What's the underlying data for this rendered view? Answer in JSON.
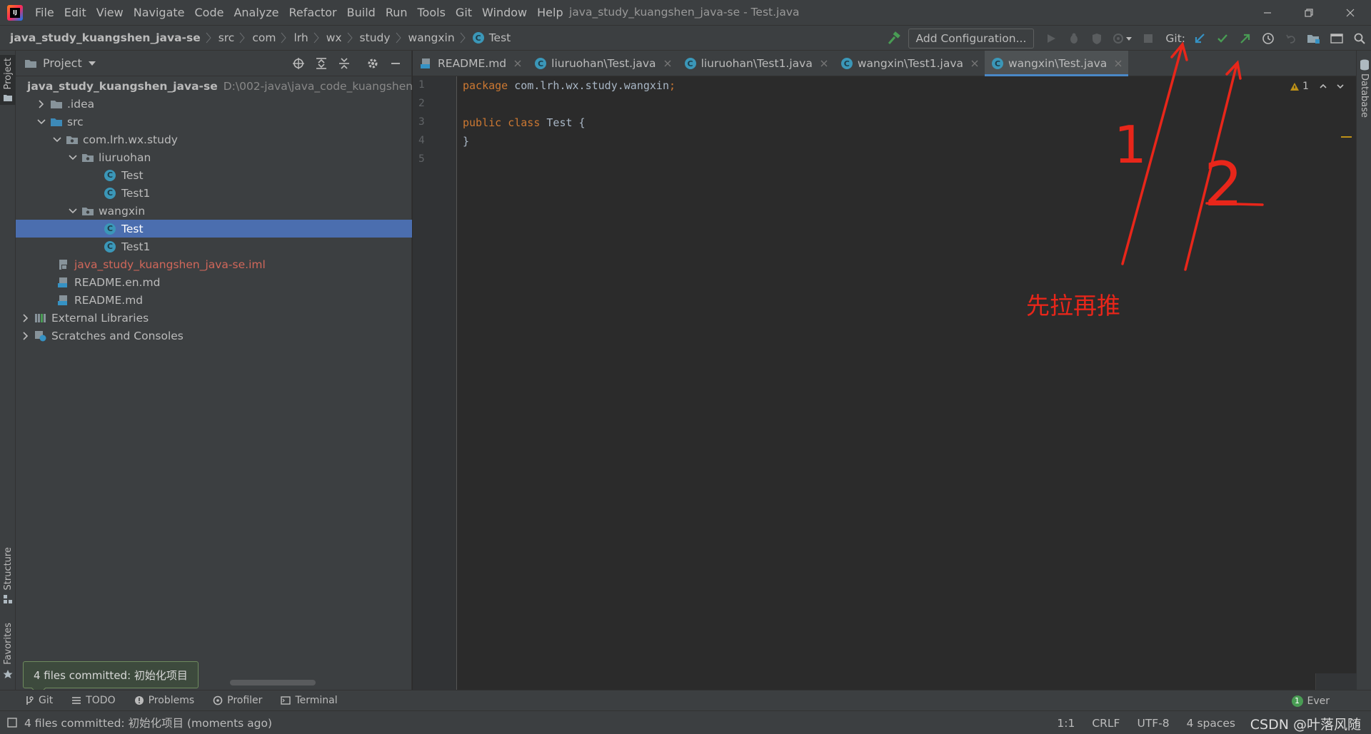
{
  "window": {
    "title": "java_study_kuangshen_java-se - Test.java",
    "menu": [
      "File",
      "Edit",
      "View",
      "Navigate",
      "Code",
      "Analyze",
      "Refactor",
      "Build",
      "Run",
      "Tools",
      "Git",
      "Window",
      "Help"
    ]
  },
  "navbar": {
    "breadcrumbs": [
      "java_study_kuangshen_java-se",
      "src",
      "com",
      "lrh",
      "wx",
      "study",
      "wangxin",
      "Test"
    ],
    "add_config_label": "Add Configuration...",
    "git_label": "Git:"
  },
  "left_stripe": {
    "project": "Project",
    "structure": "Structure",
    "favorites": "Favorites"
  },
  "right_stripe": {
    "database": "Database"
  },
  "project_panel": {
    "title": "Project",
    "tree": [
      {
        "label": "java_study_kuangshen_java-se",
        "path": "D:\\002-java\\java_code_kuangshen\\ja",
        "icon": "module-folder"
      },
      {
        "label": ".idea",
        "icon": "folder"
      },
      {
        "label": "src",
        "icon": "source-folder"
      },
      {
        "label": "com.lrh.wx.study",
        "icon": "package"
      },
      {
        "label": "liuruohan",
        "icon": "package"
      },
      {
        "label": "Test",
        "icon": "class"
      },
      {
        "label": "Test1",
        "icon": "class"
      },
      {
        "label": "wangxin",
        "icon": "package"
      },
      {
        "label": "Test",
        "icon": "class"
      },
      {
        "label": "Test1",
        "icon": "class"
      },
      {
        "label": "java_study_kuangshen_java-se.iml",
        "icon": "iml-file"
      },
      {
        "label": "README.en.md",
        "icon": "markdown-file"
      },
      {
        "label": "README.md",
        "icon": "markdown-file"
      },
      {
        "label": "External Libraries",
        "icon": "library"
      },
      {
        "label": "Scratches and Consoles",
        "icon": "scratches"
      }
    ]
  },
  "editor": {
    "tabs": [
      {
        "label": "README.md",
        "icon": "markdown-file"
      },
      {
        "label": "liuruohan\\Test.java",
        "icon": "class"
      },
      {
        "label": "liuruohan\\Test1.java",
        "icon": "class"
      },
      {
        "label": "wangxin\\Test1.java",
        "icon": "class"
      },
      {
        "label": "wangxin\\Test.java",
        "icon": "class"
      }
    ],
    "line_numbers": [
      "1",
      "2",
      "3",
      "4",
      "5"
    ],
    "code": {
      "l1_kw": "package",
      "l1_rest": " com.lrh.wx.study.wangxin",
      "l1_semi": ";",
      "l3_kw1": "public",
      "l3_kw2": "class",
      "l3_name": "Test",
      "l3_brace": " {",
      "l4": "}"
    },
    "inspection_count": "1"
  },
  "bottom_tools": {
    "git": "Git",
    "todo": "TODO",
    "problems": "Problems",
    "profiler": "Profiler",
    "terminal": "Terminal",
    "event_log": "Ever",
    "event_badge": "1"
  },
  "balloon": {
    "text": "4 files committed: 初始化项目"
  },
  "statusbar": {
    "message": "4 files committed: 初始化项目 (moments ago)",
    "position": "1:1",
    "line_sep": "CRLF",
    "encoding": "UTF-8",
    "indent": "4 spaces",
    "watermark": "CSDN @叶落风随"
  },
  "annotations": {
    "label_1": "1",
    "label_2": "2",
    "caption": "先拉再推",
    "color": "#e8261a"
  }
}
